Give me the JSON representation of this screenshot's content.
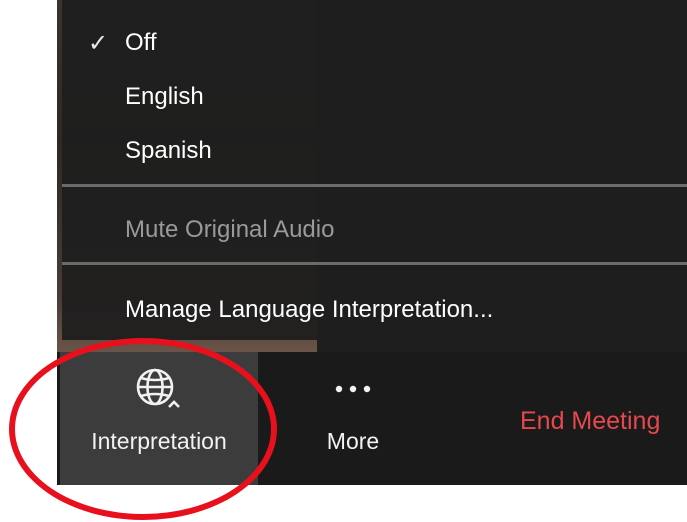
{
  "menu": {
    "items": [
      {
        "label": "Off",
        "checked": true
      },
      {
        "label": "English",
        "checked": false
      },
      {
        "label": "Spanish",
        "checked": false
      }
    ],
    "check_glyph": "✓",
    "mute_original_audio": "Mute Original Audio",
    "manage_label": "Manage Language Interpretation..."
  },
  "toolbar": {
    "interpretation_label": "Interpretation",
    "more_label": "More",
    "more_glyph": "•••",
    "end_meeting_label": "End Meeting"
  },
  "colors": {
    "menu_bg": "#1e1e1e",
    "toolbar_bg": "#1a1a1a",
    "end_meeting": "#e5484d",
    "annotation_circle": "#e8101c"
  },
  "icons": {
    "interpretation": "globe-icon",
    "more": "ellipsis-icon"
  }
}
